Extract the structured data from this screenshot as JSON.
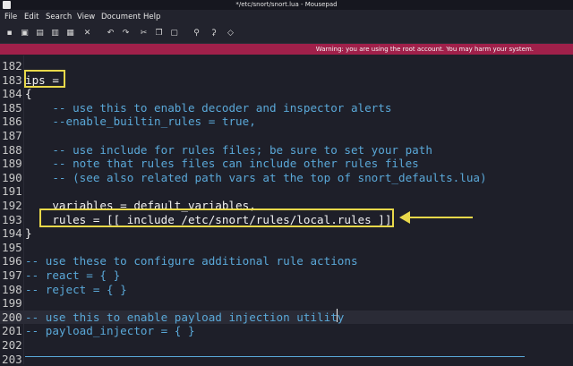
{
  "window": {
    "title": "*/etc/snort/snort.lua - Mousepad"
  },
  "menu": [
    "File",
    "Edit",
    "Search",
    "View",
    "Document",
    "Help"
  ],
  "toolbar_icons": [
    "new-file-icon",
    "open-file-icon",
    "save-icon",
    "save-as-icon",
    "reload-icon",
    "close-icon",
    "undo-icon",
    "redo-icon",
    "cut-icon",
    "copy-icon",
    "paste-icon",
    "find-icon",
    "find-replace-icon",
    "goto-icon"
  ],
  "warning": "Warning: you are using the root account. You may harm your system.",
  "editor": {
    "current_line": "200",
    "lines": [
      {
        "n": "182",
        "text": ""
      },
      {
        "n": "183",
        "text": "ips ="
      },
      {
        "n": "184",
        "text": "{"
      },
      {
        "n": "185",
        "text": "    -- use this to enable decoder and inspector alerts"
      },
      {
        "n": "186",
        "text": "    --enable_builtin_rules = true,"
      },
      {
        "n": "187",
        "text": ""
      },
      {
        "n": "188",
        "text": "    -- use include for rules files; be sure to set your path"
      },
      {
        "n": "189",
        "text": "    -- note that rules files can include other rules files"
      },
      {
        "n": "190",
        "text": "    -- (see also related path vars at the top of snort_defaults.lua)"
      },
      {
        "n": "191",
        "text": ""
      },
      {
        "n": "192",
        "text": "    variables = default_variables,"
      },
      {
        "n": "193",
        "text": "    rules = [[ include /etc/snort/rules/local.rules ]]"
      },
      {
        "n": "194",
        "text": "}"
      },
      {
        "n": "195",
        "text": ""
      },
      {
        "n": "196",
        "text": "-- use these to configure additional rule actions"
      },
      {
        "n": "197",
        "text": "-- react = { }"
      },
      {
        "n": "198",
        "text": "-- reject = { }"
      },
      {
        "n": "199",
        "text": ""
      },
      {
        "n": "200",
        "text": "-- use this to enable payload injection utility"
      },
      {
        "n": "201",
        "text": "-- payload_injector = { }"
      },
      {
        "n": "202",
        "text": ""
      },
      {
        "n": "203",
        "text": ""
      }
    ]
  },
  "colors": {
    "comment": "#5aa8d8",
    "code": "#f0f0f0",
    "highlight": "#e8d84a",
    "warning_bg": "#a0204a"
  }
}
